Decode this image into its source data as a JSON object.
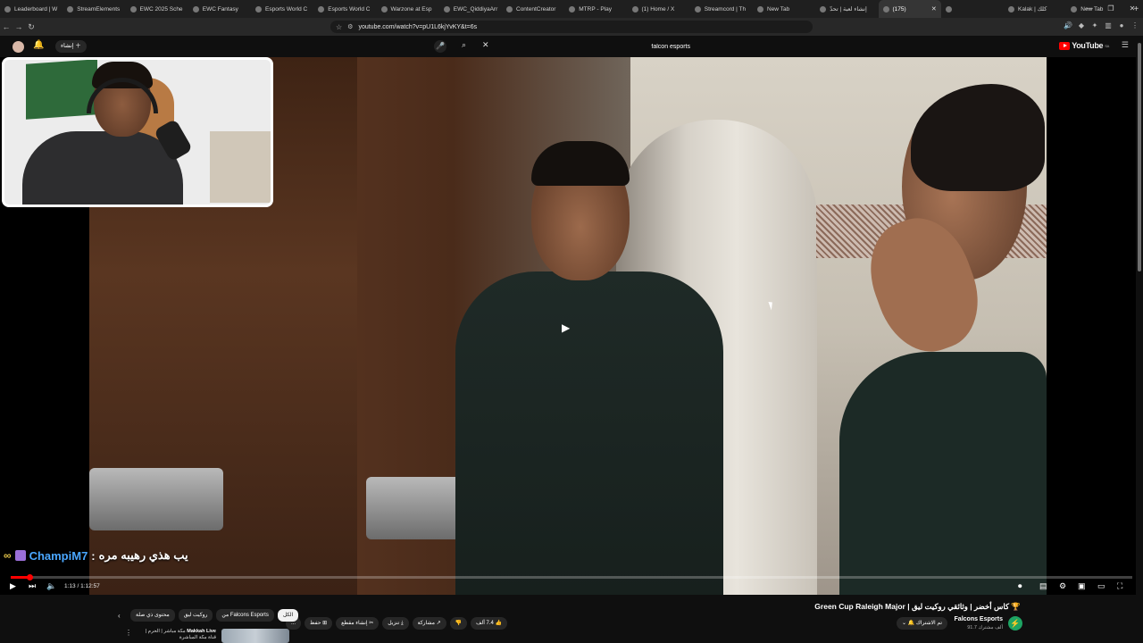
{
  "browser": {
    "tabs": [
      {
        "label": "Leaderboard | W",
        "active": false
      },
      {
        "label": "StreamElements",
        "active": false
      },
      {
        "label": "EWC 2025 Sche",
        "active": false
      },
      {
        "label": "EWC Fantasy",
        "active": false
      },
      {
        "label": "Esports World C",
        "active": false
      },
      {
        "label": "Esports World C",
        "active": false
      },
      {
        "label": "Warzone at Esp",
        "active": false
      },
      {
        "label": "EWC_QiddiyaArr",
        "active": false
      },
      {
        "label": "ContentCreator",
        "active": false
      },
      {
        "label": "MTRP - Play",
        "active": false
      },
      {
        "label": "(1) Home / X",
        "active": false
      },
      {
        "label": "Streamcord | Th",
        "active": false
      },
      {
        "label": "New Tab",
        "active": false
      },
      {
        "label": "إنشاء لعبة | تحدّ",
        "active": false
      },
      {
        "label": "(175)",
        "active": true
      },
      {
        "label": "",
        "active": false
      },
      {
        "label": "Kalak | كلك",
        "active": false
      },
      {
        "label": "New Tab",
        "active": false
      }
    ],
    "new_tab_symbol": "+",
    "window_controls": [
      "—",
      "❐",
      "✕"
    ],
    "url": "youtube.com/watch?v=pU1L6kjYvKY&t=6s"
  },
  "youtube": {
    "create_label": "إنشاء",
    "search_value": "falcon esports",
    "logo_text": "YouTube",
    "logo_sup": "SA"
  },
  "chat": {
    "username": "ChampiM7",
    "separator": ":",
    "message": "يب هذي رهيبه مره"
  },
  "player": {
    "time_current": "1:13",
    "time_total": "1:12:57",
    "progress": 0.017
  },
  "video": {
    "title": "🏆 كاس أخضر | وثائقي روكيت ليق | Green Cup Raleigh Major",
    "channel_name": "Falcons Esports",
    "channel_subs": "91.7 ألف مشترك",
    "subscribe_label": "تم الاشتراك",
    "likes": "7.4 ألف",
    "share_label": "مشاركة",
    "download_label": "تنزيل",
    "clip_label": "إنشاء مقطع",
    "save_label": "حفظ",
    "more_label": "..."
  },
  "chips": {
    "items": [
      {
        "label": "الكل",
        "active": true
      },
      {
        "label": "من Falcons Esports",
        "active": false
      },
      {
        "label": "روكيت ليق",
        "active": false
      },
      {
        "label": "محتوى ذي صلة",
        "active": false
      }
    ]
  },
  "recommendation": {
    "channel": "Makkah Live",
    "text": "مكة مباشر | الحرم | قناة مكة المباشرة"
  },
  "colors": {
    "accent_red": "#ff0000",
    "chat_name": "#4aa7ff",
    "channel_avatar": "#1ea463"
  }
}
